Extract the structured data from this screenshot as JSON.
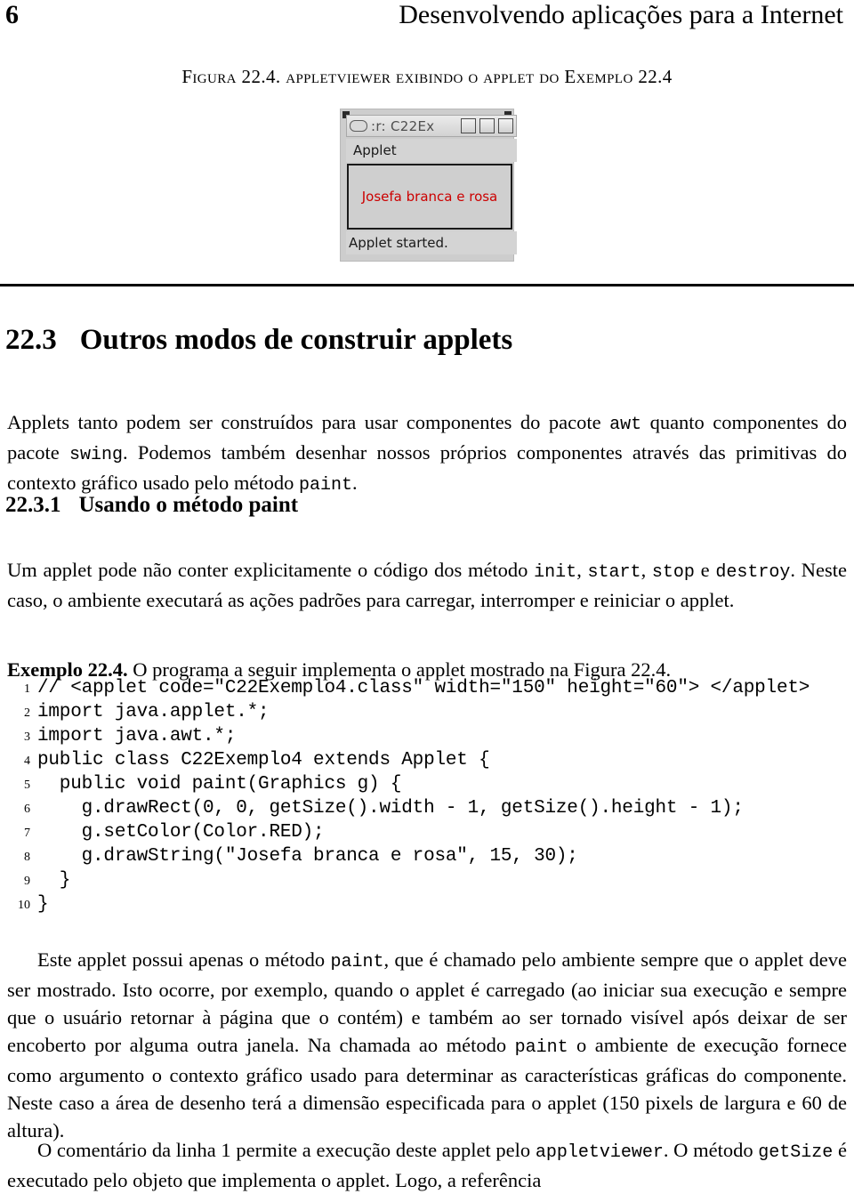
{
  "header": {
    "folio": "6",
    "running_title": "Desenvolvendo aplicações para a Internet"
  },
  "figure": {
    "caption_lead": "Figura 22.4.",
    "caption_rest": " appletviewer exibindo o applet do Exemplo 22.4",
    "applet_window": {
      "title": ":r: C22Ex",
      "menu_label": "Applet",
      "canvas_text": "Josefa branca e rosa",
      "canvas_text_color": "#cc0000",
      "status_text": "Applet started.",
      "window_bg": "#cdcdcd",
      "titlebar_buttons": 3
    }
  },
  "section": {
    "number": "22.3",
    "title": "Outros modos de construir applets",
    "intro_parts": [
      "Applets tanto podem ser construídos para usar componentes do pacote ",
      "awt",
      " quanto componentes do pacote ",
      "swing",
      ". Podemos também desenhar nossos próprios componentes através das primitivas do contexto gráfico usado pelo método ",
      "paint",
      "."
    ]
  },
  "subsection": {
    "number": "22.3.1",
    "title": "Usando o método paint",
    "paragraph_parts": [
      "Um applet pode não conter explicitamente o código dos método ",
      "init",
      ", ",
      "start",
      ", ",
      "stop",
      " e ",
      "destroy",
      ". Neste caso, o ambiente executará as ações padrões para carregar, interromper e reiniciar o applet."
    ],
    "example_label": "Exemplo 22.4.",
    "example_text": " O programa a seguir implementa o applet mostrado na Figura 22.4."
  },
  "listing": {
    "lines": [
      {
        "n": "1",
        "code": "// <applet code=\"C22Exemplo4.class\" width=\"150\" height=\"60\"> </applet>"
      },
      {
        "n": "2",
        "code": "import java.applet.*;"
      },
      {
        "n": "3",
        "code": "import java.awt.*;"
      },
      {
        "n": "4",
        "code": "public class C22Exemplo4 extends Applet {"
      },
      {
        "n": "5",
        "code": "  public void paint(Graphics g) {"
      },
      {
        "n": "6",
        "code": "    g.drawRect(0, 0, getSize().width - 1, getSize().height - 1);"
      },
      {
        "n": "7",
        "code": "    g.setColor(Color.RED);"
      },
      {
        "n": "8",
        "code": "    g.drawString(\"Josefa branca e rosa\", 15, 30);"
      },
      {
        "n": "9",
        "code": "  }"
      },
      {
        "n": "10",
        "code": "}"
      }
    ]
  },
  "closing": {
    "para1_parts": [
      "Este applet possui apenas o método ",
      "paint",
      ", que é chamado pelo ambiente sempre que o applet deve ser mostrado. Isto ocorre, por exemplo, quando o applet é carregado (ao iniciar sua execução e sempre que o usuário retornar à página que o contém) e também ao ser tornado visível após deixar de ser encoberto por alguma outra janela. Na chamada ao método ",
      "paint",
      " o ambiente de execução fornece como argumento o contexto gráfico usado para determinar as características gráficas do componente. Neste caso a área de desenho terá a dimensão especificada para o applet (150 pixels de largura e 60 de altura)."
    ],
    "para2_parts": [
      "O comentário da linha 1 permite a execução deste applet pelo ",
      "appletviewer",
      ". O método ",
      "getSize",
      " é executado pelo objeto que implementa o applet. Logo, a referência"
    ]
  }
}
